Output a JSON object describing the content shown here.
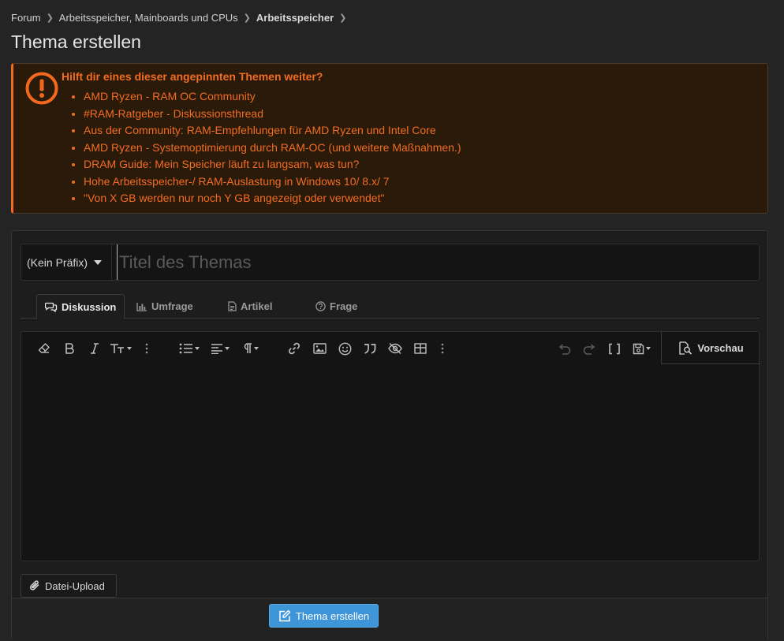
{
  "breadcrumb": {
    "items": [
      "Forum",
      "Arbeitsspeicher, Mainboards und CPUs",
      "Arbeitsspeicher"
    ]
  },
  "page": {
    "title": "Thema erstellen"
  },
  "notice": {
    "title": "Hilft dir eines dieser angepinnten Themen weiter?",
    "links": [
      "AMD Ryzen - RAM OC Community",
      "#RAM-Ratgeber - Diskussionsthread",
      "Aus der Community: RAM-Empfehlungen für AMD Ryzen und Intel Core",
      "AMD Ryzen - Systemoptimierung durch RAM-OC (und weitere Maßnahmen.)",
      "DRAM Guide: Mein Speicher läuft zu langsam, was tun?",
      "Hohe Arbeitsspeicher-/ RAM-Auslastung in Windows 10/ 8.x/ 7",
      "\"Von X GB werden nur noch Y GB angezeigt oder verwendet\""
    ],
    "accent_color": "#f2691d"
  },
  "form": {
    "prefix_label": "(Kein Präfix)",
    "title_placeholder": "Titel des Themas",
    "tabs": [
      {
        "label": "Diskussion",
        "icon": "comments-icon"
      },
      {
        "label": "Umfrage",
        "icon": "bar-chart-icon"
      },
      {
        "label": "Artikel",
        "icon": "document-icon"
      },
      {
        "label": "Frage",
        "icon": "question-circle-icon"
      }
    ],
    "preview_label": "Vorschau",
    "upload_label": "Datei-Upload",
    "submit_label": "Thema erstellen",
    "submit_color": "#3e95d8"
  }
}
